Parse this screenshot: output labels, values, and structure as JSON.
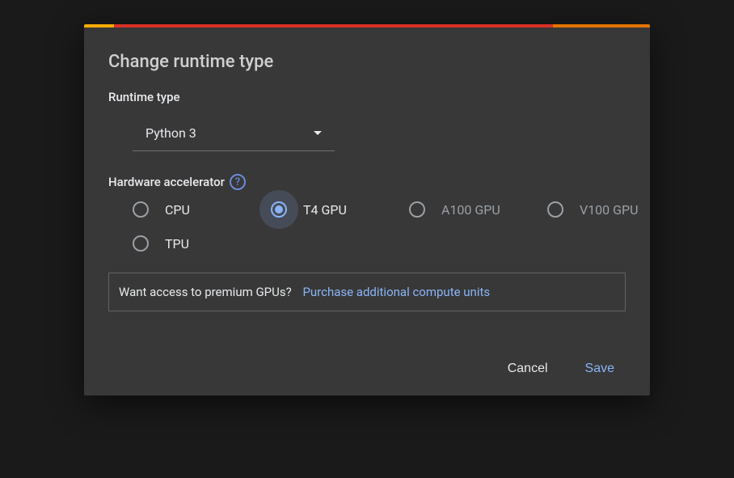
{
  "dialog": {
    "title": "Change runtime type",
    "runtime_type_label": "Runtime type",
    "runtime_type_value": "Python 3",
    "accelerator_label": "Hardware accelerator",
    "accelerators": [
      {
        "label": "CPU",
        "selected": false,
        "enabled": true
      },
      {
        "label": "T4 GPU",
        "selected": true,
        "enabled": true
      },
      {
        "label": "A100 GPU",
        "selected": false,
        "enabled": false
      },
      {
        "label": "V100 GPU",
        "selected": false,
        "enabled": false
      },
      {
        "label": "TPU",
        "selected": false,
        "enabled": true
      }
    ],
    "upsell_text": "Want access to premium GPUs?",
    "upsell_link": "Purchase additional compute units",
    "cancel_label": "Cancel",
    "save_label": "Save"
  }
}
